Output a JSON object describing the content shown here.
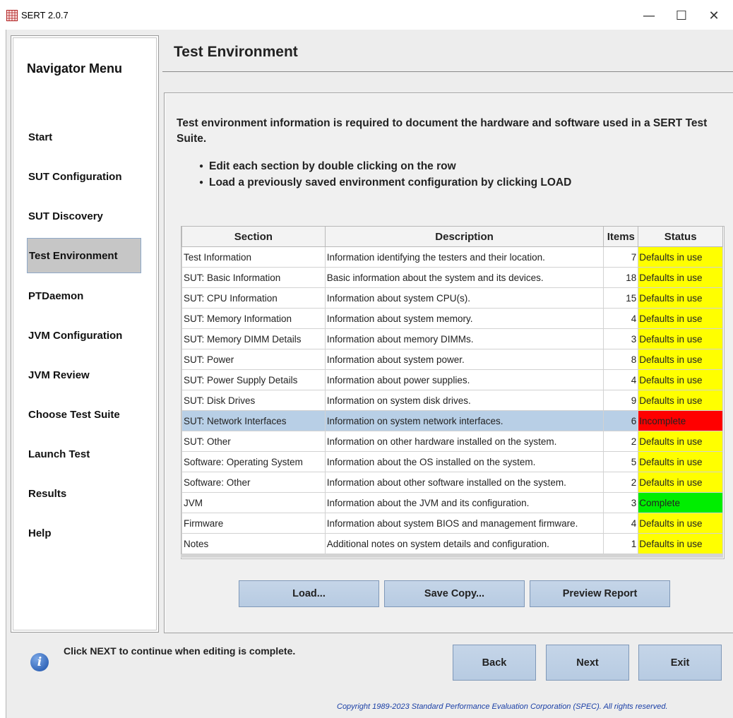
{
  "window": {
    "title": "SERT 2.0.7",
    "minimize": "—",
    "maximize": "☐",
    "close": "✕"
  },
  "nav": {
    "title": "Navigator Menu",
    "items": [
      {
        "label": "Start",
        "active": false
      },
      {
        "label": "SUT Configuration",
        "active": false
      },
      {
        "label": "SUT Discovery",
        "active": false
      },
      {
        "label": "Test Environment",
        "active": true
      },
      {
        "label": "PTDaemon",
        "active": false
      },
      {
        "label": "JVM Configuration",
        "active": false
      },
      {
        "label": "JVM Review",
        "active": false
      },
      {
        "label": "Choose Test Suite",
        "active": false
      },
      {
        "label": "Launch Test",
        "active": false
      },
      {
        "label": "Results",
        "active": false
      },
      {
        "label": "Help",
        "active": false
      }
    ]
  },
  "page": {
    "title": "Test Environment",
    "intro": "Test environment information is required to document the hardware and software used in a SERT Test Suite.",
    "bullets": [
      "Edit each section by double clicking on the row",
      "Load a previously saved environment configuration by clicking LOAD"
    ]
  },
  "table": {
    "headers": [
      "Section",
      "Description",
      "Items",
      "Status"
    ],
    "rows": [
      {
        "section": "Test Information",
        "description": "Information identifying the testers and their location.",
        "items": "7",
        "status": "Defaults in use",
        "state": "default",
        "selected": false
      },
      {
        "section": "SUT: Basic Information",
        "description": "Basic information about the system and its devices.",
        "items": "18",
        "status": "Defaults in use",
        "state": "default",
        "selected": false
      },
      {
        "section": "SUT: CPU Information",
        "description": "Information about system CPU(s).",
        "items": "15",
        "status": "Defaults in use",
        "state": "default",
        "selected": false
      },
      {
        "section": "SUT: Memory Information",
        "description": "Information about system memory.",
        "items": "4",
        "status": "Defaults in use",
        "state": "default",
        "selected": false
      },
      {
        "section": "SUT: Memory DIMM Details",
        "description": "Information about memory DIMMs.",
        "items": "3",
        "status": "Defaults in use",
        "state": "default",
        "selected": false
      },
      {
        "section": "SUT: Power",
        "description": "Information about system power.",
        "items": "8",
        "status": "Defaults in use",
        "state": "default",
        "selected": false
      },
      {
        "section": "SUT: Power Supply Details",
        "description": "Information about power supplies.",
        "items": "4",
        "status": "Defaults in use",
        "state": "default",
        "selected": false
      },
      {
        "section": "SUT: Disk Drives",
        "description": "Information on system disk drives.",
        "items": "9",
        "status": "Defaults in use",
        "state": "default",
        "selected": false
      },
      {
        "section": "SUT: Network Interfaces",
        "description": "Information on system network interfaces.",
        "items": "6",
        "status": "Incomplete",
        "state": "incomplete",
        "selected": true
      },
      {
        "section": "SUT: Other",
        "description": "Information on other hardware installed on the system.",
        "items": "2",
        "status": "Defaults in use",
        "state": "default",
        "selected": false
      },
      {
        "section": "Software: Operating System",
        "description": "Information about the OS installed on the system.",
        "items": "5",
        "status": "Defaults in use",
        "state": "default",
        "selected": false
      },
      {
        "section": "Software: Other",
        "description": "Information about other software installed on the system.",
        "items": "2",
        "status": "Defaults in use",
        "state": "default",
        "selected": false
      },
      {
        "section": "JVM",
        "description": "Information about the JVM and its configuration.",
        "items": "3",
        "status": "Complete",
        "state": "complete",
        "selected": false
      },
      {
        "section": "Firmware",
        "description": "Information about system BIOS and management firmware.",
        "items": "4",
        "status": "Defaults in use",
        "state": "default",
        "selected": false
      },
      {
        "section": "Notes",
        "description": "Additional notes on system details and configuration.",
        "items": "1",
        "status": "Defaults in use",
        "state": "default",
        "selected": false
      }
    ]
  },
  "actions": {
    "load": "Load...",
    "save_copy": "Save Copy...",
    "preview": "Preview Report"
  },
  "footer": {
    "message": "Click NEXT to continue when editing is complete.",
    "back": "Back",
    "next": "Next",
    "exit": "Exit",
    "copyright": "Copyright 1989-2023 Standard Performance Evaluation Corporation (SPEC). All rights reserved."
  },
  "colors": {
    "default_status": "#ffff00",
    "incomplete_status": "#ff0000",
    "complete_status": "#00ee00",
    "selected_row": "#b8cfe6",
    "button": "#bccfe6"
  }
}
